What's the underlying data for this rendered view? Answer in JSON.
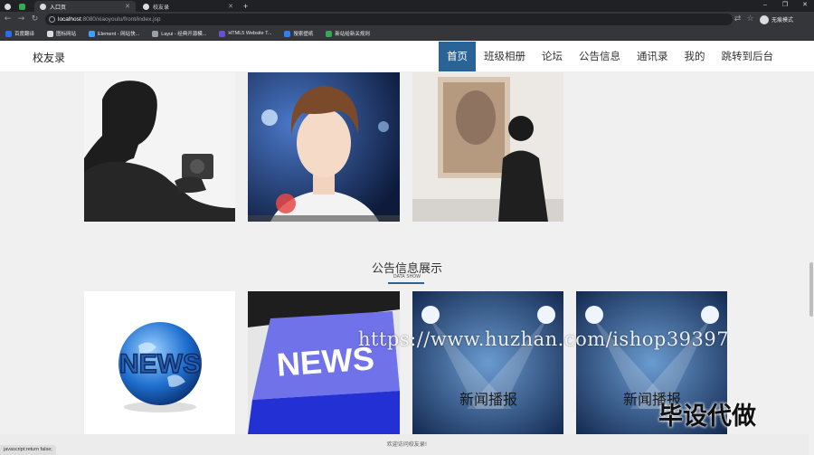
{
  "browser": {
    "tabs": [
      {
        "title": "入口页",
        "active": true
      },
      {
        "title": "校友录",
        "active": false
      }
    ],
    "url_host": "localhost",
    "url_path": ":8080/xiaoyoulu/front/index.jsp",
    "profile_label": "无痕模式",
    "bookmarks": [
      {
        "label": "百度翻译",
        "color": "#2e6be6"
      },
      {
        "label": "图标网站",
        "color": "#202124"
      },
      {
        "label": "Element - 网站快...",
        "color": "#409eff"
      },
      {
        "label": "Layui - 经典开源模...",
        "color": "#202124"
      },
      {
        "label": "HTML5 Website T...",
        "color": "#6b4fd3"
      },
      {
        "label": "搜索壁纸",
        "color": "#2f80ed"
      },
      {
        "label": "新站给新关规则",
        "color": "#34a853"
      }
    ]
  },
  "site": {
    "logo": "校友录",
    "nav": [
      {
        "label": "首页",
        "active": true
      },
      {
        "label": "班级相册",
        "active": false
      },
      {
        "label": "论坛",
        "active": false
      },
      {
        "label": "公告信息",
        "active": false
      },
      {
        "label": "通讯录",
        "active": false
      },
      {
        "label": "我的",
        "active": false
      },
      {
        "label": "跳转到后台",
        "active": false
      }
    ]
  },
  "section": {
    "title": "公告信息展示",
    "subtitle": "DATA SHOW"
  },
  "news_images": [
    {
      "name": "news-globe-image",
      "text": "NEWS"
    },
    {
      "name": "news-key-image",
      "text": "NEWS"
    },
    {
      "name": "news-broadcast-image-1",
      "text": "新闻播报"
    },
    {
      "name": "news-broadcast-image-2",
      "text": "新闻播报"
    }
  ],
  "watermark": "https://www.huzhan.com/ishop39397",
  "stamp": "毕设代做",
  "footer": "欢迎访问校友录!",
  "status_url": "javascript:return false;"
}
